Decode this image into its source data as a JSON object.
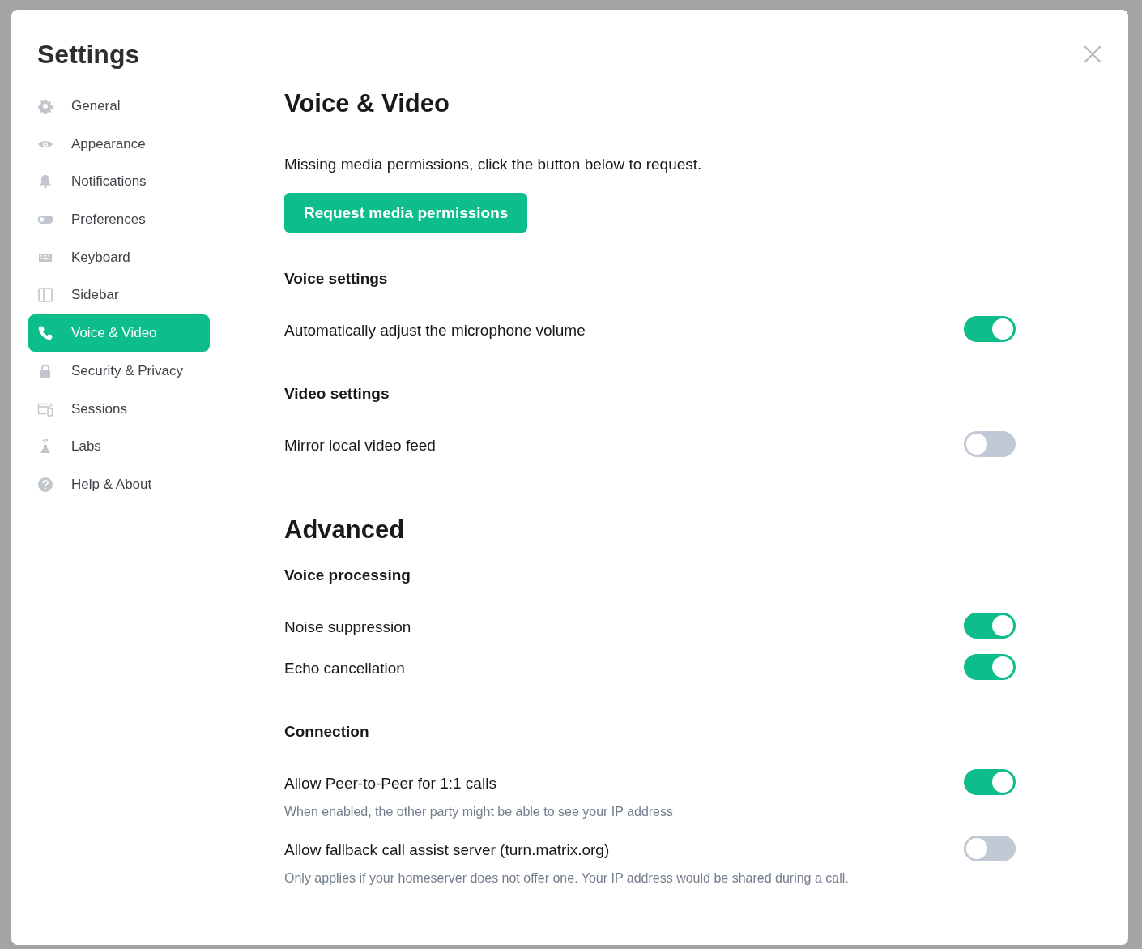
{
  "dialog": {
    "title": "Settings"
  },
  "sidebar": {
    "items": [
      {
        "label": "General",
        "kind": "gear",
        "selected": false
      },
      {
        "label": "Appearance",
        "kind": "eye",
        "selected": false
      },
      {
        "label": "Notifications",
        "kind": "bell",
        "selected": false
      },
      {
        "label": "Preferences",
        "kind": "toggle",
        "selected": false
      },
      {
        "label": "Keyboard",
        "kind": "keyboard",
        "selected": false
      },
      {
        "label": "Sidebar",
        "kind": "panel",
        "selected": false
      },
      {
        "label": "Voice & Video",
        "kind": "phone",
        "selected": true
      },
      {
        "label": "Security & Privacy",
        "kind": "lock",
        "selected": false
      },
      {
        "label": "Sessions",
        "kind": "devices",
        "selected": false
      },
      {
        "label": "Labs",
        "kind": "flask",
        "selected": false
      },
      {
        "label": "Help & About",
        "kind": "help",
        "selected": false
      }
    ]
  },
  "content": [
    {
      "kind": "heading",
      "text": "Voice & Video"
    },
    {
      "kind": "text",
      "text": "Missing media permissions, click the button below to request."
    },
    {
      "kind": "button",
      "text": "Request media permissions"
    },
    {
      "kind": "subheading",
      "text": "Voice settings"
    },
    {
      "kind": "toggle",
      "label": "Automatically adjust the microphone volume",
      "on": true
    },
    {
      "kind": "subheading",
      "text": "Video settings"
    },
    {
      "kind": "toggle",
      "label": "Mirror local video feed",
      "on": false
    },
    {
      "kind": "heading",
      "text": "Advanced"
    },
    {
      "kind": "subheading",
      "text": "Voice processing"
    },
    {
      "kind": "toggle",
      "label": "Noise suppression",
      "on": true
    },
    {
      "kind": "toggle",
      "label": "Echo cancellation",
      "on": true
    },
    {
      "kind": "subheading",
      "text": "Connection"
    },
    {
      "kind": "toggle",
      "label": "Allow Peer-to-Peer for 1:1 calls",
      "on": true,
      "description": "When enabled, the other party might be able to see your IP address"
    },
    {
      "kind": "toggle",
      "label": "Allow fallback call assist server (turn.matrix.org)",
      "on": false,
      "description": "Only applies if your homeserver does not offer one. Your IP address would be shared during a call."
    }
  ]
}
